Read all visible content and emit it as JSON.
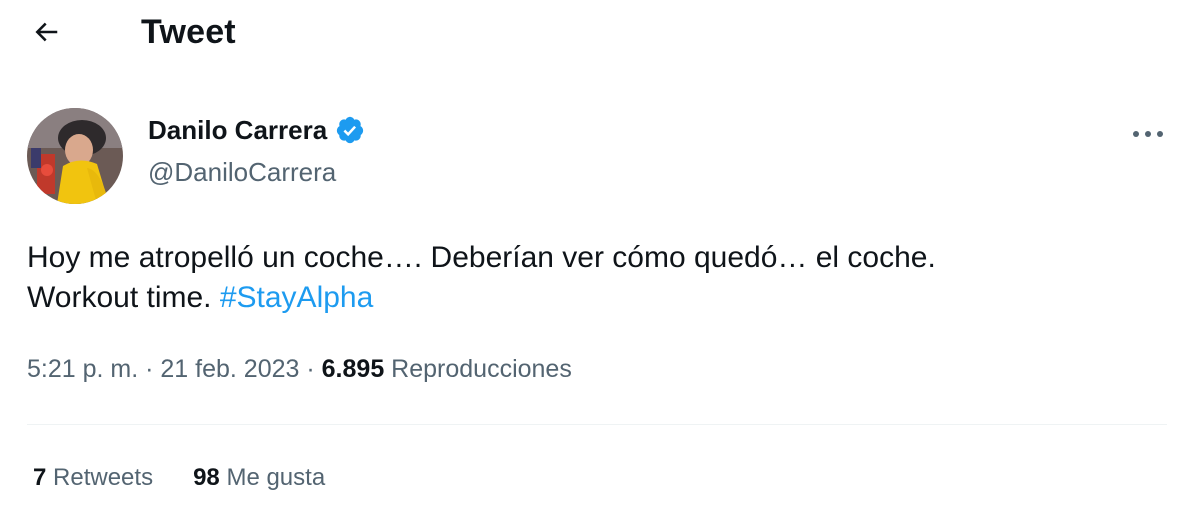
{
  "header": {
    "title": "Tweet",
    "back_icon": "arrow-left-icon"
  },
  "author": {
    "name": "Danilo Carrera",
    "handle": "@DaniloCarrera",
    "verified_icon": "verified-badge-icon",
    "verified_color": "#1d9bf0"
  },
  "more_icon": "more-dots-icon",
  "tweet": {
    "text_line1": "Hoy me atropelló un coche…. Deberían ver cómo quedó… el coche.",
    "text_line2": "Workout time.",
    "hashtag": "#StayAlpha",
    "hashtag_color": "#1d9bf0"
  },
  "meta": {
    "time": "5:21 p. m.",
    "separator": "·",
    "date": "21 feb. 2023",
    "views_count": "6.895",
    "views_label": "Reproducciones"
  },
  "stats": {
    "retweets_count": "7",
    "retweets_label": "Retweets",
    "likes_count": "98",
    "likes_label": "Me gusta"
  },
  "colors": {
    "text_primary": "#0f1419",
    "text_secondary": "#536471",
    "divider": "#eff3f4"
  }
}
